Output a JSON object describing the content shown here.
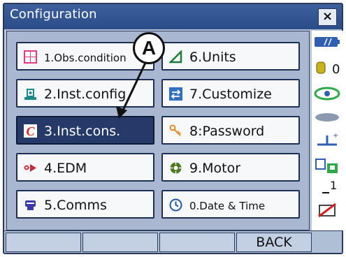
{
  "window": {
    "title": "Configuration",
    "close_label": "×"
  },
  "menu": [
    {
      "label": "1.Obs.condition",
      "icon": "obs-condition-icon"
    },
    {
      "label": "6.Units",
      "icon": "units-icon"
    },
    {
      "label": "2.Inst.config",
      "icon": "inst-config-icon"
    },
    {
      "label": "7.Customize",
      "icon": "customize-icon"
    },
    {
      "label": "3.Inst.cons.",
      "icon": "inst-cons-icon",
      "selected": true
    },
    {
      "label": "8:Password",
      "icon": "key-icon"
    },
    {
      "label": "4.EDM",
      "icon": "edm-icon"
    },
    {
      "label": "9.Motor",
      "icon": "motor-icon"
    },
    {
      "label": "5.Comms",
      "icon": "comms-icon"
    },
    {
      "label": "0.Date & Time",
      "icon": "clock-icon"
    }
  ],
  "status": {
    "battery_icon": "battery-icon",
    "prism_constant": "0",
    "tilt_level": "1"
  },
  "softkeys": {
    "back_label": "BACK"
  },
  "callout": {
    "label": "A"
  },
  "colors": {
    "title_bar": "#2a4c88",
    "selected_button": "#263a6a",
    "panel": "#a9b8d0"
  }
}
